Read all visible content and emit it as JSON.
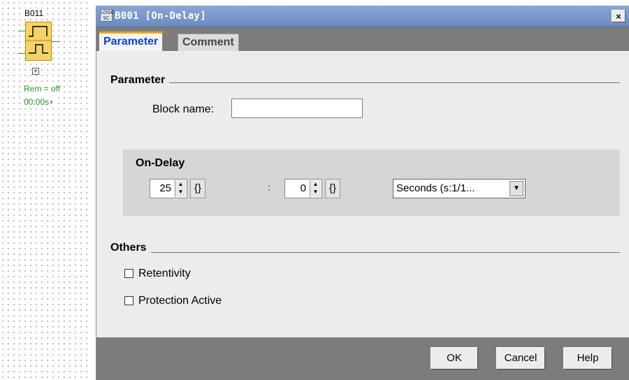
{
  "canvas": {
    "block_label": "B011",
    "rem_text": "Rem = off",
    "time_text": "00:00s+",
    "expand_icon": "plus-box-icon"
  },
  "dialog": {
    "title": "B001 [On-Delay]",
    "app_icon_text": "LOGO SC",
    "close_label": "×",
    "tabs": [
      {
        "label": "Parameter",
        "active": true
      },
      {
        "label": "Comment",
        "active": false
      }
    ],
    "parameter_section": {
      "title": "Parameter",
      "block_name_label": "Block name:",
      "block_name_value": ""
    },
    "on_delay": {
      "title": "On-Delay",
      "value_major": "25",
      "value_minor": "0",
      "separator": ":",
      "unit": "Seconds (s:1/1..."
    },
    "others_section": {
      "title": "Others",
      "retentivity_label": "Retentivity",
      "retentivity_checked": false,
      "protection_label": "Protection Active",
      "protection_checked": false
    },
    "buttons": {
      "ok": "OK",
      "cancel": "Cancel",
      "help": "Help"
    }
  },
  "colors": {
    "titlebar": "#7d98cc",
    "tab_active_text": "#0b44c8",
    "tab_accent": "#f2a11b",
    "block_fill": "#f4d36a",
    "wire": "#3a9a3a",
    "dialog_bg": "#ececec",
    "band_bg": "#7c7c7c"
  }
}
